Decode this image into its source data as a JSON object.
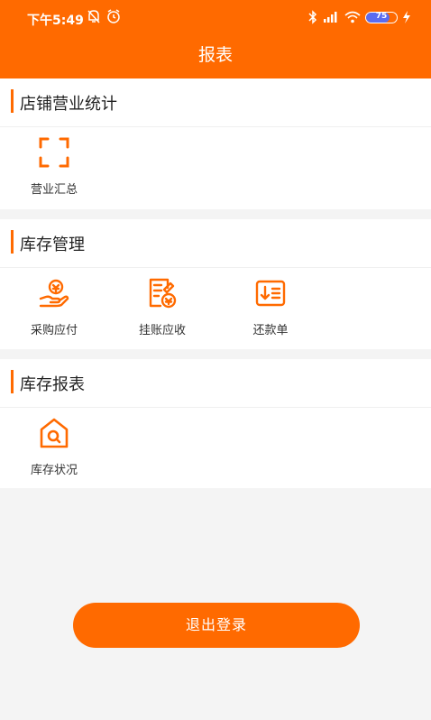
{
  "status_bar": {
    "time": "下午5:49",
    "battery": "75",
    "battery_level": 0.75,
    "icons": [
      "bell-off-icon",
      "alarm-icon",
      "bluetooth-icon",
      "cellular-signal-icon",
      "wifi-icon",
      "battery-icon",
      "charging-icon"
    ]
  },
  "header": {
    "title": "报表",
    "background_color": "#ff6a00"
  },
  "sections": [
    {
      "title": "店铺营业统计",
      "items": [
        {
          "label": "营业汇总",
          "icon": "scan-frame-icon"
        }
      ]
    },
    {
      "title": "库存管理",
      "items": [
        {
          "label": "采购应付",
          "icon": "hand-coin-icon"
        },
        {
          "label": "挂账应收",
          "icon": "ledger-receipt-icon"
        },
        {
          "label": "还款单",
          "icon": "repayment-list-icon"
        }
      ]
    },
    {
      "title": "库存报表",
      "items": [
        {
          "label": "库存状况",
          "icon": "house-search-icon"
        }
      ]
    }
  ],
  "logout": {
    "label": "退出登录"
  },
  "accent_color": "#ff6a00"
}
